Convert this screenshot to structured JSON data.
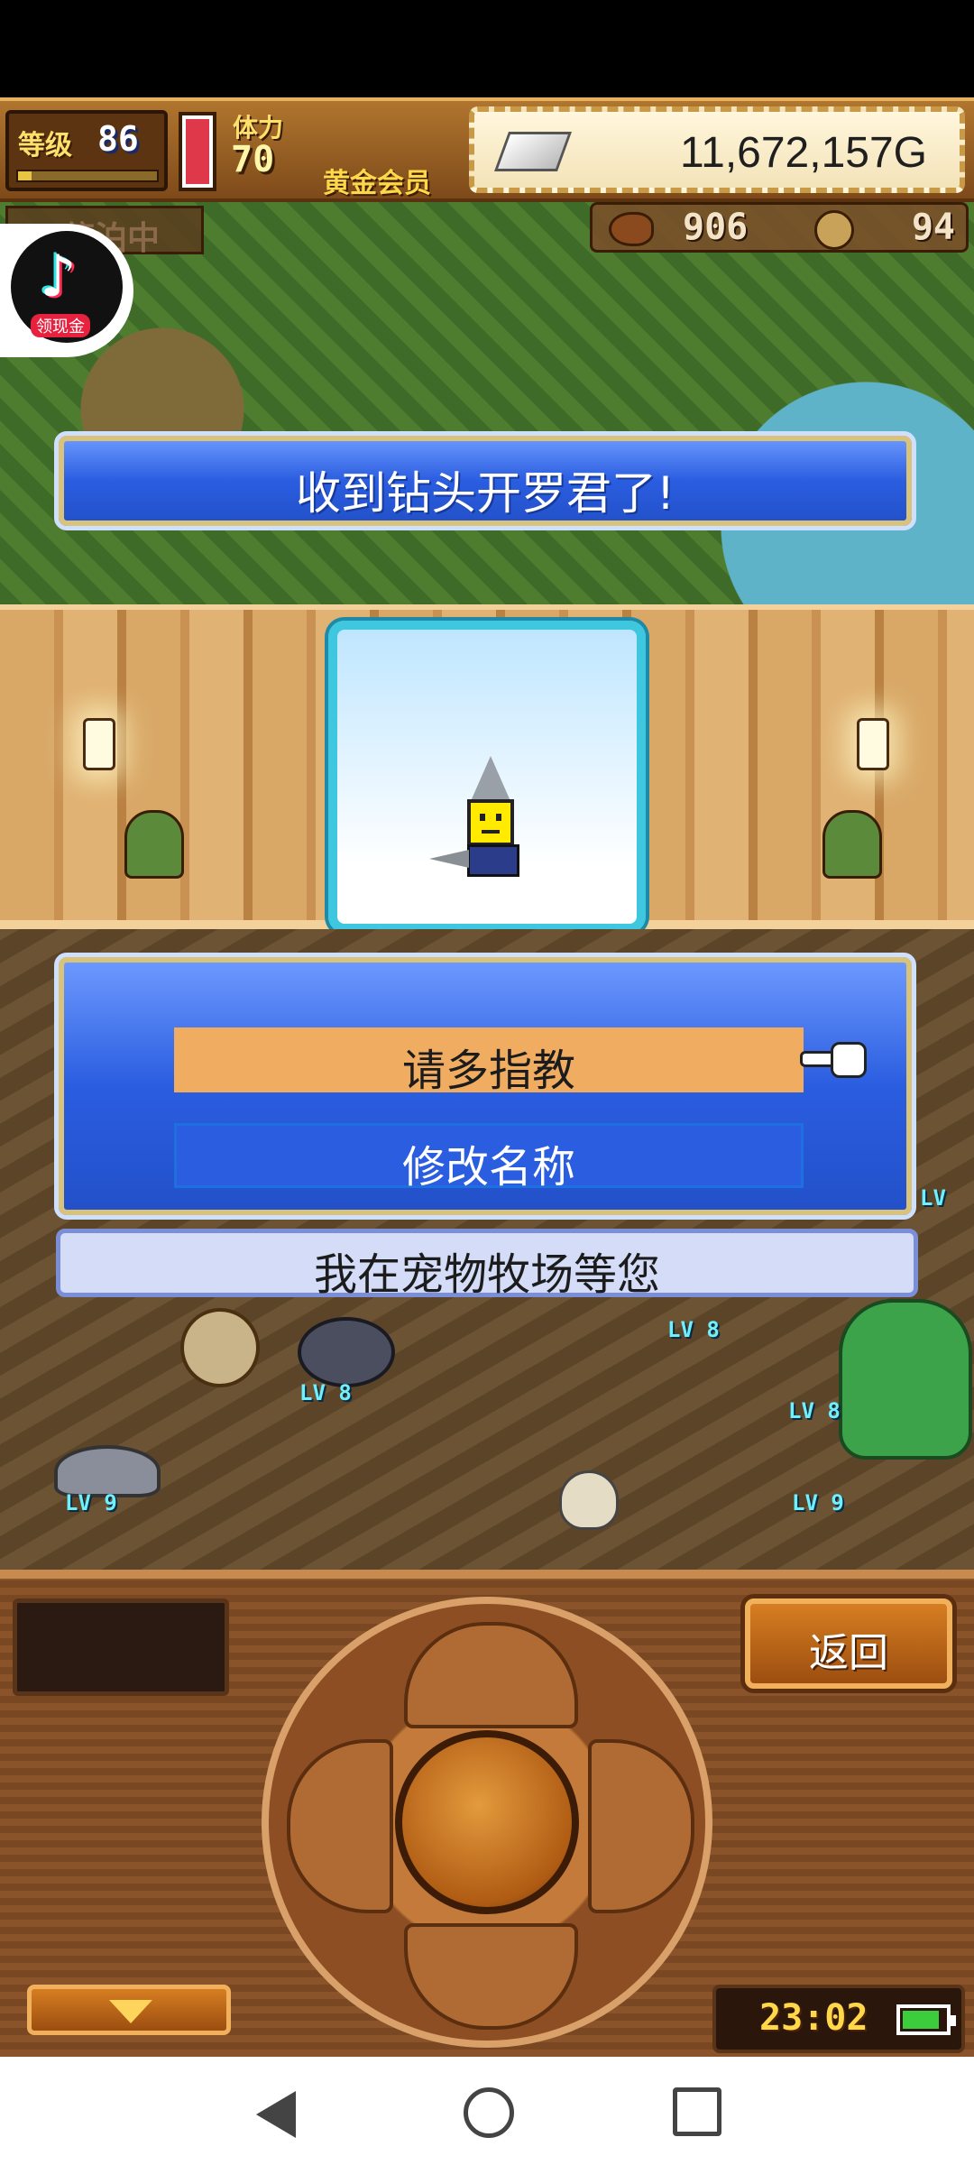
{
  "hud": {
    "level_label": "等级",
    "level_value": "86",
    "stamina_label": "体力",
    "stamina_value": "70",
    "member_label": "黄金会员",
    "gold_amount": "11,672,157G",
    "food_count": "906",
    "medal_count": "94",
    "mode_label": "停泊中"
  },
  "tiktok": {
    "badge_label": "领现金"
  },
  "notice": {
    "message": "收到钻头开罗君了!"
  },
  "menu": {
    "option_greet": "请多指教",
    "option_rename": "修改名称",
    "footer_message": "我在宠物牧场等您"
  },
  "monsters": {
    "level_tags": [
      "LV 8",
      "LV 8",
      "LV 9",
      "LV 9",
      "LV 8",
      "LV"
    ]
  },
  "controls": {
    "back_label": "返回",
    "clock": "23:02"
  },
  "colors": {
    "accent_blue": "#2a5de0",
    "highlight_orange": "#f0ad62",
    "panel_brown": "#8a532a",
    "battery_green": "#3ccd3c"
  }
}
